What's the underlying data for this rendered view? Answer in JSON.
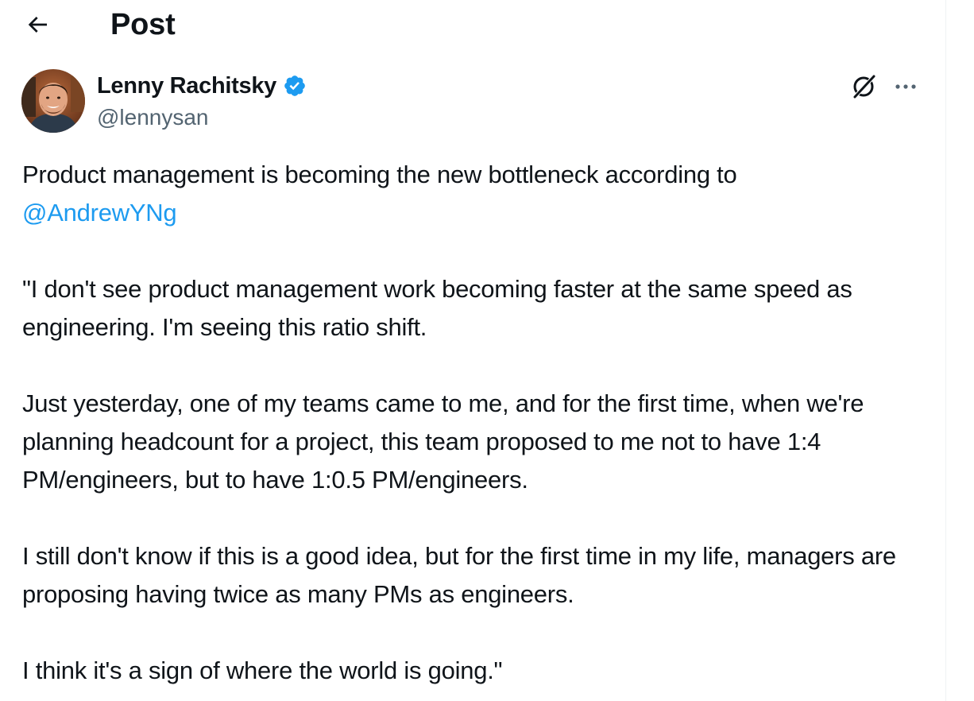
{
  "header": {
    "back_icon": "arrow-left-icon",
    "title": "Post"
  },
  "author": {
    "name": "Lenny Rachitsky",
    "handle": "@lennysan",
    "verified_icon": "verified-badge-icon",
    "verified_color": "#1d9bf0"
  },
  "actions": {
    "grok_icon": "grok-icon",
    "more_icon": "more-horizontal-icon"
  },
  "post": {
    "line1": "Product management is becoming the new bottleneck according to",
    "mention": "@AndrewYNg",
    "p2": "\"I don't see product management work becoming faster at the same speed as engineering. I'm seeing this ratio shift.",
    "p3": "Just yesterday, one of my teams came to me, and for the first time, when we're planning headcount for a project, this team proposed to me not to have 1:4 PM/engineers, but to have 1:0.5 PM/engineers.",
    "p4": "I still don't know if this is a good idea, but for the first time in my life, managers are proposing having twice as many PMs as engineers.",
    "p5": "I think it's a sign of where the world is going.\""
  },
  "colors": {
    "text": "#0f1419",
    "secondary": "#536471",
    "accent": "#1d9bf0"
  }
}
